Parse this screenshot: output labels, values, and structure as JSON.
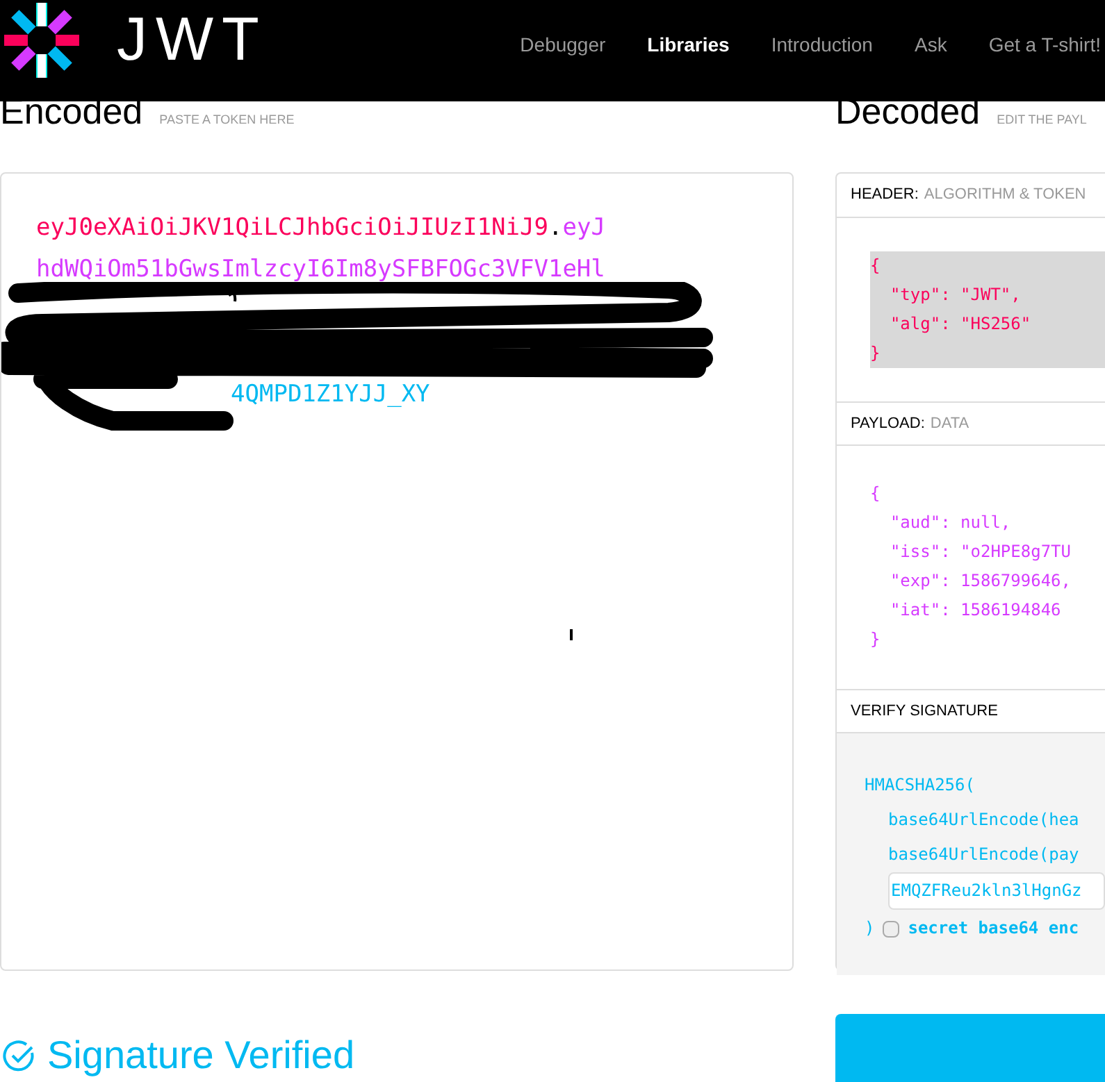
{
  "nav": {
    "logo_text": "JWT",
    "items": [
      {
        "label": "Debugger",
        "selected": false
      },
      {
        "label": "Libraries",
        "selected": true
      },
      {
        "label": "Introduction",
        "selected": false
      },
      {
        "label": "Ask",
        "selected": false
      },
      {
        "label": "Get a T-shirt!",
        "selected": false
      }
    ]
  },
  "encoded": {
    "title": "Encoded",
    "hint": "PASTE A TOKEN HERE",
    "lines": [
      [
        {
          "kind": "header",
          "text": "eyJ0eXAiOiJKV1QiLCJhbGciOiJIUzI1NiJ9"
        },
        {
          "kind": "dot",
          "text": "."
        },
        {
          "kind": "payload",
          "text": "eyJ"
        }
      ],
      [
        {
          "kind": "payload",
          "text": "hdWQiOm51bGwsImlzcyI6Im8ySFBFOGc3VFV1eHl"
        }
      ],
      [
        {
          "kind": "signature",
          "text": "4QMPD1Z1YJJ_XY"
        }
      ]
    ]
  },
  "decoded": {
    "title": "Decoded",
    "hint": "EDIT THE PAYL",
    "header": {
      "label": "HEADER:",
      "sub": "ALGORITHM & TOKEN",
      "lines": [
        "{",
        "  \"typ\": \"JWT\",",
        "  \"alg\": \"HS256\"",
        "}"
      ]
    },
    "payload": {
      "label": "PAYLOAD:",
      "sub": "DATA",
      "lines": [
        "{",
        "  \"aud\": null,",
        "  \"iss\": \"o2HPE8g7TU",
        "  \"exp\": 1586799646,",
        "  \"iat\": 1586194846",
        "}"
      ]
    },
    "verify": {
      "label": "VERIFY SIGNATURE",
      "fn": "HMACSHA256(",
      "args": [
        "base64UrlEncode(hea",
        "base64UrlEncode(pay"
      ],
      "secret": "EMQZFReu2kln3lHgnGz",
      "close": ")",
      "checkbox": {
        "label": "secret base64 enc",
        "checked": false
      }
    }
  },
  "status": {
    "text": "Signature Verified"
  }
}
